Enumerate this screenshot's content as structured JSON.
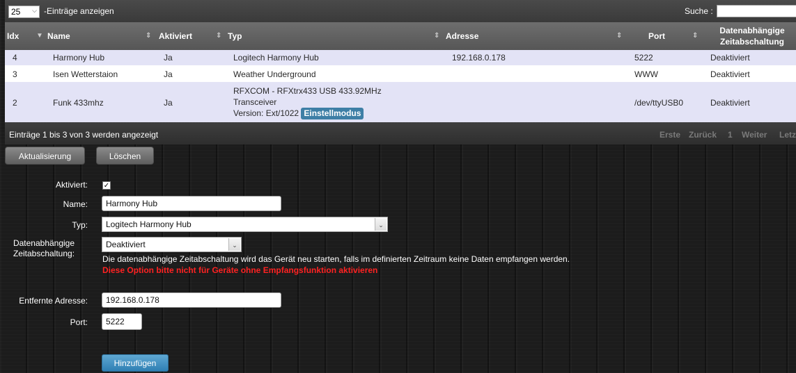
{
  "table": {
    "length_value": "25",
    "length_label": "-Einträge anzeigen",
    "search_label": "Suche :",
    "search_value": "",
    "columns": {
      "idx": "Idx",
      "name": "Name",
      "activated": "Aktiviert",
      "type": "Typ",
      "address": "Adresse",
      "port": "Port",
      "timeout_line1": "Datenabhängige",
      "timeout_line2": "Zeitabschaltung"
    },
    "rows": [
      {
        "idx": "4",
        "name": "Harmony Hub",
        "activated": "Ja",
        "type_line1": "Logitech Harmony Hub",
        "type_line2": "",
        "type_line3": "",
        "badge": "",
        "address": "192.168.0.178",
        "port": "5222",
        "timeout": "Deaktiviert"
      },
      {
        "idx": "3",
        "name": "Isen Wetterstaion",
        "activated": "Ja",
        "type_line1": "Weather Underground",
        "type_line2": "",
        "type_line3": "",
        "badge": "",
        "address": "",
        "port": "WWW",
        "timeout": "Deaktiviert"
      },
      {
        "idx": "2",
        "name": "Funk 433mhz",
        "activated": "Ja",
        "type_line1": "RFXCOM - RFXtrx433 USB 433.92MHz",
        "type_line2": "Transceiver",
        "type_line3": "Version: Ext/1022",
        "badge": "Einstellmodus",
        "address": "",
        "port": "/dev/ttyUSB0",
        "timeout": "Deaktiviert"
      }
    ],
    "info": "Einträge 1 bis 3 von 3 werden angezeigt",
    "pager": {
      "first": "Erste",
      "prev": "Zurück",
      "page": "1",
      "next": "Weiter",
      "last": "Letz"
    }
  },
  "actions": {
    "update": "Aktualisierung",
    "delete": "Löschen"
  },
  "form": {
    "activated_label": "Aktiviert:",
    "activated_checked": true,
    "name_label": "Name:",
    "name_value": "Harmony Hub",
    "type_label": "Typ:",
    "type_value": "Logitech Harmony Hub",
    "timeout_label_line1": "Datenabhängige",
    "timeout_label_line2": "Zeitabschaltung:",
    "timeout_value": "Deaktiviert",
    "timeout_help": "Die datenabhängige Zeitabschaltung wird das Gerät neu starten, falls im definierten Zeitraum keine Daten empfangen werden.",
    "timeout_warning": "Diese Option bitte nicht für Geräte ohne Empfangsfunktion aktivieren",
    "address_label": "Entfernte Adresse:",
    "address_value": "192.168.0.178",
    "port_label": "Port:",
    "port_value": "5222",
    "add_button": "Hinzufügen"
  },
  "icons": {
    "sort_desc": "triangle-down-icon",
    "sort_both": "diamond-sort-icon",
    "dropdown": "chevron-down-icon",
    "check": "checkmark-icon"
  },
  "colors": {
    "row_highlight": "#e3e3f6",
    "badge": "#3e7fa6",
    "primary_button": "#3b8fc4",
    "warning_text": "#ff2222"
  }
}
